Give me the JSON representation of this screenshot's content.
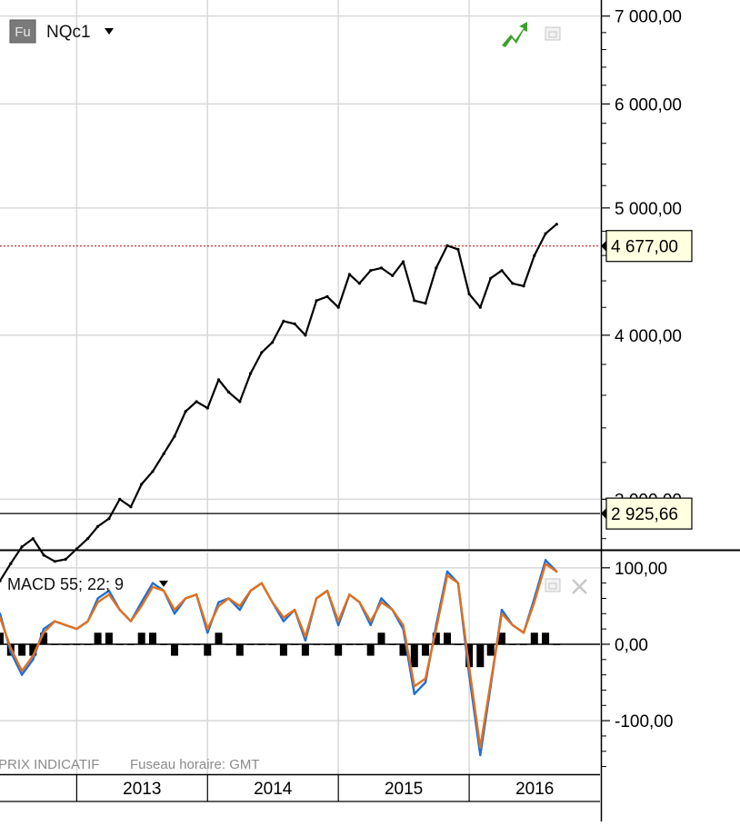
{
  "header": {
    "badge": "Fu",
    "symbol": "NQc1",
    "dropdown_icon": "triangle-down-icon",
    "trend_icon": "green-trend-arrow-icon",
    "window_icon": "restore-window-icon"
  },
  "macd_header": {
    "label": "MACD 55; 22; 9",
    "dropdown_icon": "triangle-down-icon",
    "window_icon": "restore-window-icon",
    "close_icon": "close-icon"
  },
  "footer": {
    "price_note": "PRIX INDICATIF",
    "timezone": "Fuseau horaire: GMT"
  },
  "colors": {
    "price_line": "#000000",
    "macd_line": "#1f6fd6",
    "signal_line": "#e2701d",
    "histogram": "#000000",
    "last_price_line": "#c00000",
    "label_background": "#ffffe1",
    "grid": "#d8d8d8",
    "trend_icon": "#3aa12a"
  },
  "chart_data": [
    {
      "type": "line",
      "title": "NQc1",
      "x_tick_labels": [
        "2013",
        "2014",
        "2015",
        "2016"
      ],
      "y_tick_labels": [
        "3 000,00",
        "4 000,00",
        "5 000,00",
        "6 000,00",
        "7 000,00"
      ],
      "y_ticks": [
        3000,
        4000,
        5000,
        6000,
        7000
      ],
      "y_scale": "log",
      "ylim": [
        2750,
        7200
      ],
      "xlim": [
        "2012-06-01",
        "2016-12-31"
      ],
      "grid": true,
      "last_price_label": "4 677,00",
      "last_price": 4677,
      "reference_label": "2 925,66",
      "reference_value": 2925.66,
      "series": [
        {
          "x": [
            "2012-06-01",
            "2012-07-01",
            "2012-08-01",
            "2012-09-01",
            "2012-10-01",
            "2012-11-01",
            "2012-12-01",
            "2013-01-01",
            "2013-02-01",
            "2013-03-01",
            "2013-04-01",
            "2013-05-01",
            "2013-06-01",
            "2013-07-01",
            "2013-08-01",
            "2013-09-01",
            "2013-10-01",
            "2013-11-01",
            "2013-12-01",
            "2014-01-01",
            "2014-02-01",
            "2014-03-01",
            "2014-04-01",
            "2014-05-01",
            "2014-06-01",
            "2014-07-01",
            "2014-08-01",
            "2014-09-01",
            "2014-10-01",
            "2014-11-01",
            "2014-12-01",
            "2015-01-01",
            "2015-02-01",
            "2015-03-01",
            "2015-04-01",
            "2015-05-01",
            "2015-06-01",
            "2015-07-01",
            "2015-08-01",
            "2015-09-01",
            "2015-10-01",
            "2015-11-01",
            "2015-12-01",
            "2016-01-01",
            "2016-02-01",
            "2016-03-01",
            "2016-04-01",
            "2016-05-01",
            "2016-06-01",
            "2016-07-01",
            "2016-08-01",
            "2016-09-01"
          ],
          "values": [
            2600,
            2680,
            2760,
            2800,
            2720,
            2690,
            2700,
            2750,
            2800,
            2860,
            2900,
            3000,
            2960,
            3080,
            3150,
            3250,
            3350,
            3500,
            3560,
            3520,
            3700,
            3620,
            3560,
            3740,
            3880,
            3950,
            4100,
            4080,
            4000,
            4250,
            4280,
            4200,
            4450,
            4380,
            4480,
            4500,
            4440,
            4550,
            4250,
            4230,
            4500,
            4680,
            4650,
            4300,
            4200,
            4420,
            4480,
            4380,
            4360,
            4600,
            4780,
            4860
          ]
        }
      ]
    },
    {
      "type": "line",
      "title": "MACD 55; 22; 9",
      "x_tick_labels": [
        "2013",
        "2014",
        "2015",
        "2016"
      ],
      "y_tick_labels": [
        "100,00",
        "0,00",
        "-100,00"
      ],
      "y_ticks": [
        100,
        0,
        -100
      ],
      "ylim": [
        -170,
        120
      ],
      "xlim": [
        "2012-06-01",
        "2016-12-31"
      ],
      "grid": true,
      "x": [
        "2012-06-01",
        "2012-07-01",
        "2012-08-01",
        "2012-09-01",
        "2012-10-01",
        "2012-11-01",
        "2012-12-01",
        "2013-01-01",
        "2013-02-01",
        "2013-03-01",
        "2013-04-01",
        "2013-05-01",
        "2013-06-01",
        "2013-07-01",
        "2013-08-01",
        "2013-09-01",
        "2013-10-01",
        "2013-11-01",
        "2013-12-01",
        "2014-01-01",
        "2014-02-01",
        "2014-03-01",
        "2014-04-01",
        "2014-05-01",
        "2014-06-01",
        "2014-07-01",
        "2014-08-01",
        "2014-09-01",
        "2014-10-01",
        "2014-11-01",
        "2014-12-01",
        "2015-01-01",
        "2015-02-01",
        "2015-03-01",
        "2015-04-01",
        "2015-05-01",
        "2015-06-01",
        "2015-07-01",
        "2015-08-01",
        "2015-09-01",
        "2015-10-01",
        "2015-11-01",
        "2015-12-01",
        "2016-01-01",
        "2016-02-01",
        "2016-03-01",
        "2016-04-01",
        "2016-05-01",
        "2016-06-01",
        "2016-07-01",
        "2016-08-01",
        "2016-09-01"
      ],
      "series": [
        {
          "values": [
            40,
            -10,
            -40,
            -20,
            20,
            30,
            25,
            20,
            30,
            60,
            70,
            45,
            30,
            55,
            80,
            70,
            40,
            60,
            65,
            15,
            55,
            60,
            45,
            70,
            80,
            55,
            30,
            45,
            5,
            60,
            70,
            25,
            65,
            55,
            25,
            60,
            45,
            20,
            -65,
            -50,
            25,
            95,
            80,
            -40,
            -145,
            -55,
            45,
            25,
            15,
            60,
            110,
            95
          ]
        },
        {
          "values": [
            35,
            -5,
            -35,
            -15,
            15,
            30,
            25,
            20,
            30,
            55,
            65,
            45,
            30,
            50,
            75,
            70,
            45,
            60,
            65,
            20,
            50,
            60,
            50,
            70,
            80,
            55,
            35,
            45,
            10,
            60,
            70,
            30,
            65,
            55,
            30,
            55,
            45,
            25,
            -55,
            -45,
            20,
            90,
            80,
            -30,
            -135,
            -50,
            40,
            25,
            15,
            55,
            105,
            95
          ]
        }
      ]
    }
  ]
}
